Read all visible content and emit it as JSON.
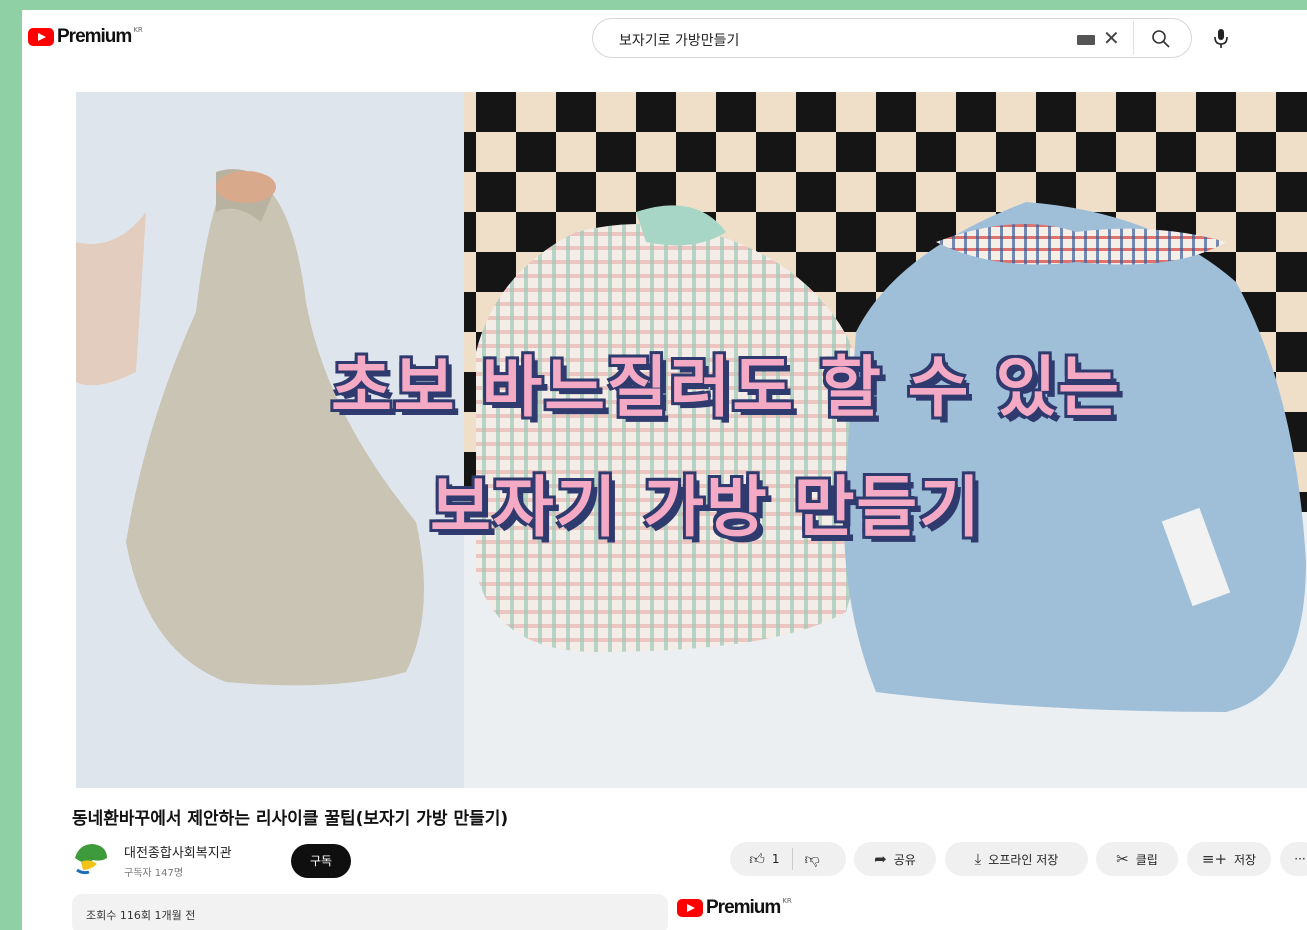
{
  "header": {
    "logo_text": "Premium",
    "logo_region": "KR",
    "search_value": "보자기로 가방만들기",
    "icons": [
      "youtube-logo-icon",
      "keyboard-icon",
      "clear-icon",
      "search-icon",
      "mic-icon"
    ]
  },
  "video": {
    "overlay_line1": "초보 바느질러도 할 수 있는",
    "overlay_line2": "보자기 가방 만들기",
    "colors": {
      "overlay_fill": "#f4a9c4",
      "overlay_outline": "#2f3a6e"
    }
  },
  "title": "동네환바꾸에서 제안하는 리사이클 꿀팁(보자기 가방 만들기)",
  "channel": {
    "name": "대전종합사회복지관",
    "subscribers": "구독자 147명",
    "subscribe_label": "구독"
  },
  "actions": {
    "like_count": "1",
    "share_label": "공유",
    "offline_label": "오프라인 저장",
    "clip_label": "클립",
    "save_label": "저장",
    "more_label": "···"
  },
  "description": {
    "meta": "조회수 116회  1개월 전"
  },
  "footer_logo": {
    "logo_text": "Premium",
    "logo_region": "KR"
  },
  "colors": {
    "brand_red": "#ff0000",
    "frame_green": "#8fd0a4"
  }
}
